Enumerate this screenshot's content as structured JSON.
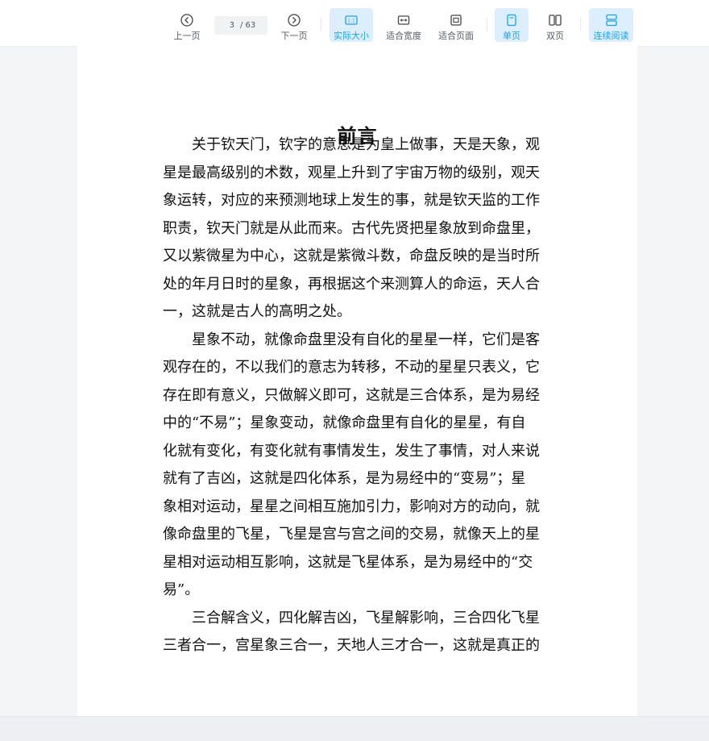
{
  "toolbar": {
    "prev_label": "上一页",
    "next_label": "下一页",
    "current_page": "3",
    "page_sep": "/",
    "total_pages": "63",
    "actual_size_label": "实际大小",
    "actual_size_icon_text": "1:1",
    "fit_width_label": "适合宽度",
    "fit_page_label": "适合页面",
    "single_page_label": "单页",
    "double_page_label": "双页",
    "continuous_label": "连续阅读",
    "accent_color": "#1aa1e6",
    "active_modes": [
      "actual-size",
      "single-page",
      "continuous-reading"
    ]
  },
  "document": {
    "title": "前言",
    "paragraphs": [
      {
        "lines": [
          "关于钦天门，钦字的意思是为皇上做事，天是天象，观",
          "星是最高级别的术数，观星上升到了宇宙万物的级别，观天",
          "象运转，对应的来预测地球上发生的事，就是钦天监的工作",
          "职责，钦天门就是从此而来。古代先贤把星象放到命盘里，",
          "又以紫微星为中心，这就是紫微斗数，命盘反映的是当时所",
          "处的年月日时的星象，再根据这个来测算人的命运，天人合",
          "一，这就是古人的高明之处。"
        ]
      },
      {
        "lines": [
          "星象不动，就像命盘里没有自化的星星一样，它们是客",
          "观存在的，不以我们的意志为转移，不动的星星只表义，它",
          "存在即有意义，只做解义即可，这就是三合体系，是为易经",
          "中的“不易”；星象变动，就像命盘里有自化的星星，有自",
          "化就有变化，有变化就有事情发生，发生了事情，对人来说",
          "就有了吉凶，这就是四化体系，是为易经中的“变易”；星",
          "象相对运动，星星之间相互施加引力，影响对方的动向，就",
          "像命盘里的飞星，飞星是宫与宫之间的交易，就像天上的星",
          "星相对运动相互影响，这就是飞星体系，是为易经中的“交",
          "易”。"
        ]
      },
      {
        "lines": [
          "三合解含义，四化解吉凶，飞星解影响，三合四化飞星",
          "三者合一，宫星象三合一，天地人三才合一，这就是真正的"
        ]
      }
    ]
  }
}
